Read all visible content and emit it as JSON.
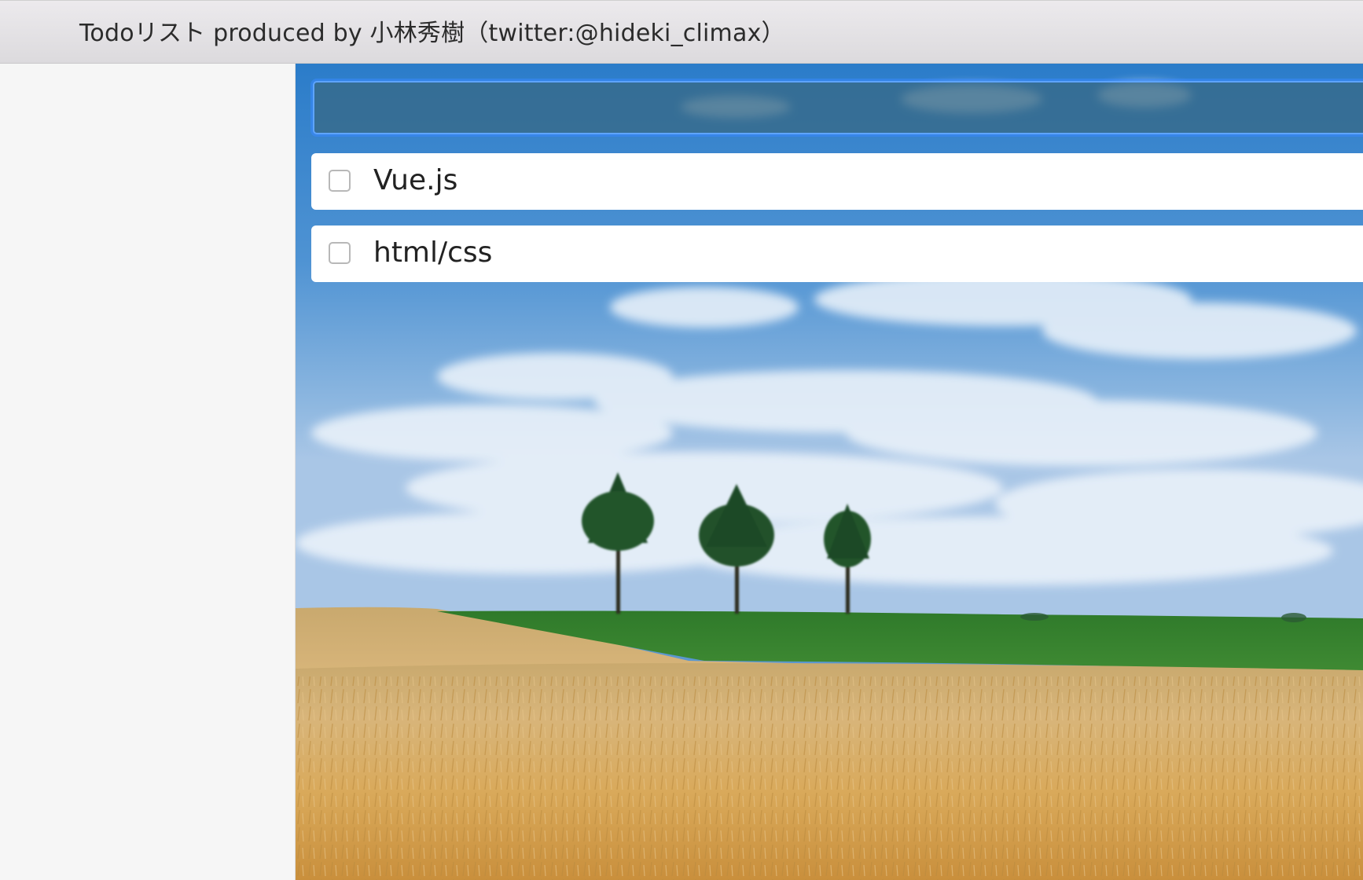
{
  "window": {
    "title": "Todoリスト produced by 小林秀樹（twitter:@hideki_climax）"
  },
  "input": {
    "value": "",
    "placeholder": ""
  },
  "todos": [
    {
      "label": "Vue.js",
      "checked": false
    },
    {
      "label": "html/css",
      "checked": false
    }
  ],
  "colors": {
    "sky": "#4f93d3",
    "input_focus_border": "#5ea4ff",
    "item_background": "#ffffff",
    "sidebar_background": "#f6f6f6"
  },
  "background_image": "landscape-photo: blue sky, three trees, green and golden wheat field"
}
